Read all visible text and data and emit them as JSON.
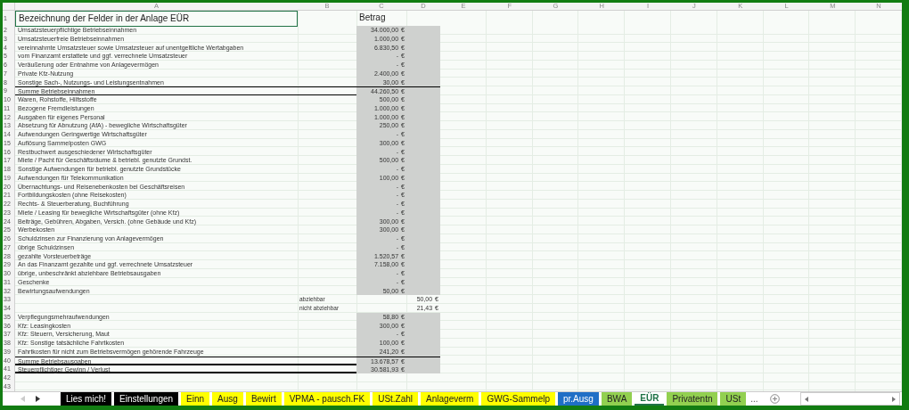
{
  "columns": [
    "A",
    "B",
    "C",
    "D",
    "E",
    "F",
    "G",
    "H",
    "I",
    "J",
    "K",
    "L",
    "M",
    "N"
  ],
  "rows": [
    {
      "number": "1",
      "kind": "header",
      "label": "Bezeichnung der Felder in der Anlage EÜR",
      "amount": "Betrag",
      "selected": true
    },
    {
      "number": "2",
      "kind": "item",
      "label": "Umsatzsteuerpflichtige Betriebseinnahmen",
      "amount": "34.000,00 €"
    },
    {
      "number": "3",
      "kind": "item",
      "label": "Umsatzsteuerfreie Betriebseinnahmen",
      "amount": "1.000,00 €"
    },
    {
      "number": "4",
      "kind": "item",
      "label": "vereinnahmte Umsatzsteuer sowie Umsatzsteuer auf unentgeltliche Wertabgaben",
      "amount": "6.830,50 €"
    },
    {
      "number": "5",
      "kind": "item",
      "label": "vom Finanzamt erstattete und ggf. verrechnete Umsatzsteuer",
      "amount": "- €"
    },
    {
      "number": "6",
      "kind": "item",
      "label": "Veräußerung oder Entnahme von Anlagevermögen",
      "amount": "- €"
    },
    {
      "number": "7",
      "kind": "item",
      "label": "Private Kfz-Nutzung",
      "amount": "2.400,00 €"
    },
    {
      "number": "8",
      "kind": "item",
      "label": "Sonstige Sach-, Nutzungs- und Leistungsentnahmen",
      "amount": "30,00 €"
    },
    {
      "number": "9",
      "kind": "sum",
      "label": "Summe Betriebseinnahmen",
      "amount": "44.260,50 €"
    },
    {
      "number": "10",
      "kind": "item",
      "label": "Waren, Rohstoffe, Hilfsstoffe",
      "amount": "500,00 €"
    },
    {
      "number": "11",
      "kind": "item",
      "label": "Bezogene Fremdleistungen",
      "amount": "1.000,00 €"
    },
    {
      "number": "12",
      "kind": "item",
      "label": "Ausgaben für eigenes Personal",
      "amount": "1.000,00 €"
    },
    {
      "number": "13",
      "kind": "item",
      "label": "Absetzung für Abnutzung (AfA) - bewegliche Wirtschaftsgüter",
      "amount": "250,00 €"
    },
    {
      "number": "14",
      "kind": "item",
      "label": "Aufwendungen Geringwertige Wirtschaftsgüter",
      "amount": "- €"
    },
    {
      "number": "15",
      "kind": "item",
      "label": "Auflösung Sammelposten GWG",
      "amount": "300,00 €"
    },
    {
      "number": "16",
      "kind": "item",
      "label": "Restbuchwert ausgeschiedener Wirtschaftsgüter",
      "amount": "- €"
    },
    {
      "number": "17",
      "kind": "item",
      "label": "Miete / Pacht für Geschäftsräume & betriebl. genutzte Grundst.",
      "amount": "500,00 €"
    },
    {
      "number": "18",
      "kind": "item",
      "label": "Sonstige Aufwendungen für betriebl. genutzte Grundstücke",
      "amount": "- €"
    },
    {
      "number": "19",
      "kind": "item",
      "label": "Aufwendungen für Telekommunikation",
      "amount": "100,00 €"
    },
    {
      "number": "20",
      "kind": "item",
      "label": "Übernachtungs- und Reisenebenkosten bei Geschäftsreisen",
      "amount": "- €"
    },
    {
      "number": "21",
      "kind": "item",
      "label": "Fortbildungskosten (ohne Reisekosten)",
      "amount": "- €"
    },
    {
      "number": "22",
      "kind": "item",
      "label": "Rechts- & Steuerberatung, Buchführung",
      "amount": "- €"
    },
    {
      "number": "23",
      "kind": "item",
      "label": "Miete / Leasing für bewegliche Wirtschaftsgüter (ohne Kfz)",
      "amount": "- €"
    },
    {
      "number": "24",
      "kind": "item",
      "label": "Beiträge, Gebühren, Abgaben, Versich. (ohne Gebäude und Kfz)",
      "amount": "300,00 €"
    },
    {
      "number": "25",
      "kind": "item",
      "label": "Werbekosten",
      "amount": "300,00 €"
    },
    {
      "number": "26",
      "kind": "item",
      "label": "Schuldzinsen zur Finanzierung von Anlagevermögen",
      "amount": "- €"
    },
    {
      "number": "27",
      "kind": "item",
      "label": "übrige Schuldzinsen",
      "amount": "- €"
    },
    {
      "number": "28",
      "kind": "item",
      "label": "gezahlte Vorsteuerbeträge",
      "amount": "1.520,57 €"
    },
    {
      "number": "29",
      "kind": "item",
      "label": "An das Finanzamt gezahlte und ggf. verrechnete Umsatzsteuer",
      "amount": "7.158,00 €"
    },
    {
      "number": "30",
      "kind": "item",
      "label": "übrige, unbeschränkt abziehbare Betriebsausgaben",
      "amount": "- €"
    },
    {
      "number": "31",
      "kind": "item",
      "label": "Geschenke",
      "amount": "- €"
    },
    {
      "number": "32",
      "kind": "item",
      "label": "Bewirtungsaufwendungen",
      "amount": "50,00 €"
    },
    {
      "number": "33",
      "kind": "split",
      "note": "abziehbar",
      "extra": "50,00 €"
    },
    {
      "number": "34",
      "kind": "split",
      "note": "nicht abziehbar",
      "extra": "21,43 €"
    },
    {
      "number": "35",
      "kind": "item",
      "label": "Verpflegungsmehraufwendungen",
      "amount": "58,80 €"
    },
    {
      "number": "36",
      "kind": "item",
      "label": "Kfz: Leasingkosten",
      "amount": "300,00 €"
    },
    {
      "number": "37",
      "kind": "item",
      "label": "Kfz: Steuern, Versicherung, Maut",
      "amount": "- €"
    },
    {
      "number": "38",
      "kind": "item",
      "label": "Kfz: Sonstige tatsächliche Fahrtkosten",
      "amount": "100,00 €"
    },
    {
      "number": "39",
      "kind": "item",
      "label": "Fahrtkosten für nicht zum Betriebsvermögen gehörende Fahrzeuge",
      "amount": "241,20 €"
    },
    {
      "number": "40",
      "kind": "sum",
      "label": "Summe Betriebsausgaben",
      "amount": "13.678,57 €"
    },
    {
      "number": "41",
      "kind": "total",
      "label": "Steuerpflichtiger Gewinn / Verlust",
      "amount": "30.581,93 €"
    },
    {
      "number": "42",
      "kind": "empty"
    },
    {
      "number": "43",
      "kind": "empty"
    }
  ],
  "tabs": [
    {
      "label": "Lies mich!",
      "color": "#000000",
      "selected": false
    },
    {
      "label": "Einstellungen",
      "color": "#000000",
      "selected": false
    },
    {
      "label": "Einn",
      "color": "#ffff00",
      "selected": false
    },
    {
      "label": "Ausg",
      "color": "#ffff00",
      "selected": false
    },
    {
      "label": "Bewirt",
      "color": "#ffff00",
      "selected": false
    },
    {
      "label": "VPMA - pausch.FK",
      "color": "#ffff00",
      "selected": false
    },
    {
      "label": "USt.Zahl",
      "color": "#ffff00",
      "selected": false
    },
    {
      "label": "Anlageverm",
      "color": "#ffff00",
      "selected": false
    },
    {
      "label": "GWG-Sammelp",
      "color": "#ffff00",
      "selected": false
    },
    {
      "label": "pr.Ausg",
      "color": "#1f6fc6",
      "selected": false
    },
    {
      "label": "BWA",
      "color": "#92d050",
      "selected": false
    },
    {
      "label": "EÜR",
      "selected": true
    },
    {
      "label": "Privatentn",
      "color": "#92d050",
      "selected": false
    },
    {
      "label": "USt",
      "color": "#92d050",
      "selected": false
    }
  ],
  "more_tabs": "..."
}
